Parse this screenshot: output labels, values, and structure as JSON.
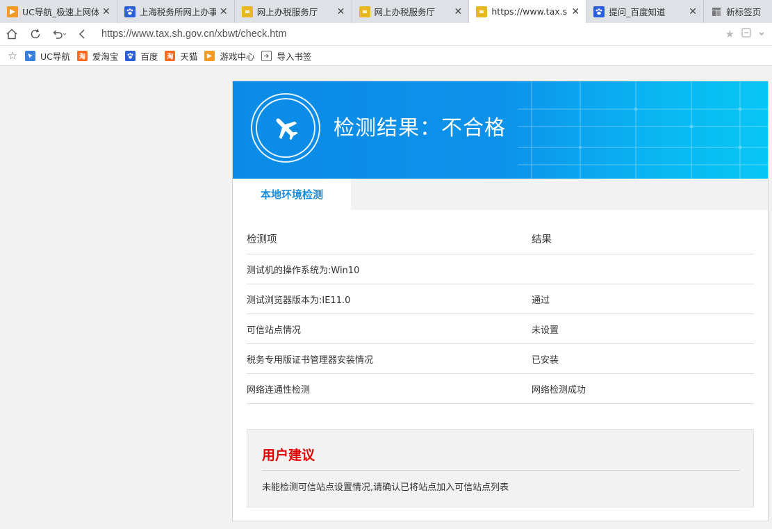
{
  "browser": {
    "tabs": [
      {
        "title": "UC导航_极速上网体验",
        "icon": "uc-icon",
        "active": false
      },
      {
        "title": "上海税务所网上办事",
        "icon": "baidu-paw-icon",
        "active": false
      },
      {
        "title": "网上办税服务厅",
        "icon": "tax-coin-icon",
        "active": false
      },
      {
        "title": "网上办税服务厅",
        "icon": "tax-coin-icon",
        "active": false
      },
      {
        "title": "https://www.tax.sh.",
        "icon": "tax-coin-icon",
        "active": true
      },
      {
        "title": "提问_百度知道",
        "icon": "baidu-paw-icon",
        "active": false
      },
      {
        "title": "新标签页",
        "icon": "new-tab-icon",
        "active": false
      }
    ],
    "url": "https://www.tax.sh.gov.cn/xbwt/check.htm",
    "bookmarks": [
      {
        "label": "UC导航",
        "icon": "uc-nav-icon"
      },
      {
        "label": "爱淘宝",
        "icon": "taobao-icon"
      },
      {
        "label": "百度",
        "icon": "baidu-paw-icon"
      },
      {
        "label": "天猫",
        "icon": "tmall-icon"
      },
      {
        "label": "游戏中心",
        "icon": "game-center-icon"
      },
      {
        "label": "导入书签",
        "icon": "import-icon"
      }
    ],
    "bookmark_glyphs": {
      "taobao": "淘",
      "tmall": "淘"
    }
  },
  "page": {
    "result_title": "检测结果：不合格",
    "section_tab": "本地环境检测",
    "table": {
      "headers": [
        "检测项",
        "结果"
      ],
      "rows": [
        [
          "测试机的操作系统为:Win10",
          ""
        ],
        [
          "测试浏览器版本为:IE11.0",
          "通过"
        ],
        [
          "可信站点情况",
          "未设置"
        ],
        [
          "税务专用版证书管理器安装情况",
          "已安装"
        ],
        [
          "网络连通性检测",
          "网络检测成功"
        ]
      ]
    },
    "advice": {
      "title": "用户建议",
      "text": "未能检测可信站点设置情况,请确认已将站点加入可信站点列表"
    }
  },
  "colors": {
    "banner": "#0b8be6",
    "accent_tab": "#1b8de0",
    "advice_title": "#e00000"
  }
}
